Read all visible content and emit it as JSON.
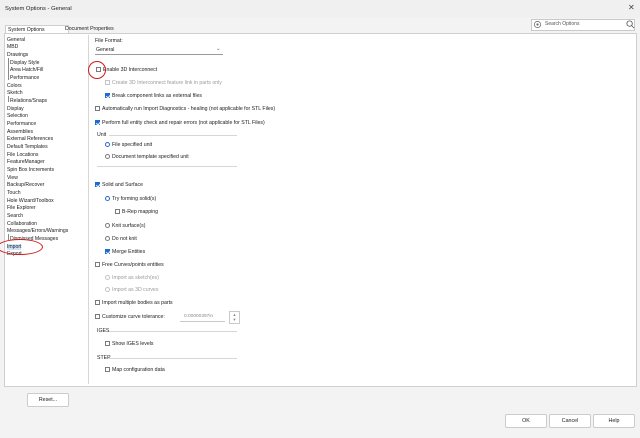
{
  "window": {
    "title": "System Options - General",
    "close_glyph": "✕"
  },
  "search": {
    "label": "Search Options"
  },
  "tabs": [
    {
      "label": "System Options"
    },
    {
      "label": "Document Properties"
    }
  ],
  "tree": {
    "items": [
      {
        "label": "General"
      },
      {
        "label": "MBD"
      },
      {
        "label": "Drawings"
      },
      {
        "label": "Display Style"
      },
      {
        "label": "Area Hatch/Fill"
      },
      {
        "label": "Performance"
      },
      {
        "label": "Colors"
      },
      {
        "label": "Sketch"
      },
      {
        "label": "Relations/Snaps"
      },
      {
        "label": "Display"
      },
      {
        "label": "Selection"
      },
      {
        "label": "Performance"
      },
      {
        "label": "Assemblies"
      },
      {
        "label": "External References"
      },
      {
        "label": "Default Templates"
      },
      {
        "label": "File Locations"
      },
      {
        "label": "FeatureManager"
      },
      {
        "label": "Spin Box Increments"
      },
      {
        "label": "View"
      },
      {
        "label": "Backup/Recover"
      },
      {
        "label": "Touch"
      },
      {
        "label": "Hole Wizard/Toolbox"
      },
      {
        "label": "File Explorer"
      },
      {
        "label": "Search"
      },
      {
        "label": "Collaboration"
      },
      {
        "label": "Messages/Errors/Warnings"
      },
      {
        "label": "Dismissed Messages"
      },
      {
        "label": "Import"
      },
      {
        "label": "Export"
      }
    ]
  },
  "file_format": {
    "label": "File Format:",
    "value": "General"
  },
  "options": {
    "enable_3d_interconnect": "Enable 3D Interconnect",
    "create_3d_link": "Create 3D Interconnect feature link in parts only",
    "break_links": "Break component links as external files",
    "auto_import_diag": "Automatically run Import Diagnostics - healing (not applicable for STL Files)",
    "full_entity_check": "Perform full entity check and repair errors (not applicable for STL Files)",
    "unit_header": "Unit",
    "file_unit": "File specified unit",
    "template_unit": "Document template specified unit",
    "solid_surface": "Solid and Surface",
    "try_forming": "Try forming solid(s)",
    "brep": "B-Rep mapping",
    "knit": "Knit surface(s)",
    "no_knit": "Do not knit",
    "merge": "Merge Entities",
    "free_curves": "Free Curves/points entities",
    "as_sketch": "Import as sketch(es)",
    "as_3d": "Import as 3D curves",
    "multiple_bodies": "Import multiple bodies as parts",
    "customize_tol": "Customize curve tolerance:",
    "tol_value": "0.00000397in",
    "iges_header": "IGES",
    "show_iges": "Show IGES levels",
    "step_header": "STEP",
    "map_config": "Map configuration data"
  },
  "buttons": {
    "reset": "Reset...",
    "ok": "OK",
    "cancel": "Cancel",
    "help": "Help"
  },
  "colors": {
    "accent": "#1f6bd0",
    "annotation": "#d0191a",
    "selection": "#cfe3f7"
  }
}
